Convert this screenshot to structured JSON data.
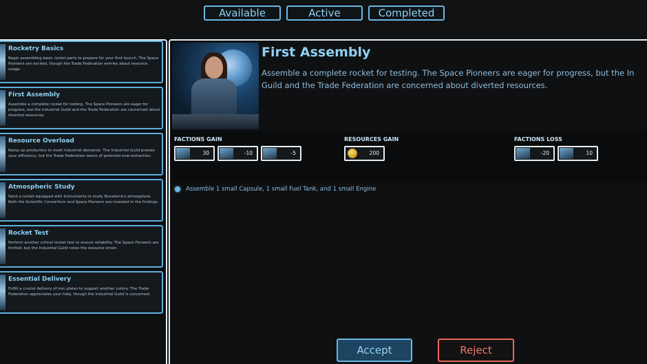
{
  "tabs": [
    {
      "label": "Available"
    },
    {
      "label": "Active"
    },
    {
      "label": "Completed"
    }
  ],
  "missions": [
    {
      "title": "Rocketry Basics",
      "description": "Begin assembling basic rocket parts to prepare for your first launch. The Space Pioneers are excited, though the Trade Federation worries about resource usage."
    },
    {
      "title": "First Assembly",
      "description": "Assemble a complete rocket for testing. The Space Pioneers are eager for progress, but the Industrial Guild and the Trade Federation are concerned about diverted resources."
    },
    {
      "title": "Resource Overload",
      "description": "Ramp up production to meet industrial demands. The Industrial Guild praises your efficiency, but the Trade Federation warns of potential over-extraction."
    },
    {
      "title": "Atmospheric Study",
      "description": "Send a rocket equipped with instruments to study Novaterra's atmosphere. Both the Scientific Consortium and Space Pioneers are invested in the findings."
    },
    {
      "title": "Rocket Test",
      "description": "Perform another critical rocket test to ensure reliability. The Space Pioneers are thrilled, but the Industrial Guild notes the resource strain."
    },
    {
      "title": "Essential Delivery",
      "description": "Fulfill a crucial delivery of iron plates to support another colony. The Trade Federation appreciates your help, though the Industrial Guild is concerned."
    }
  ],
  "detail": {
    "title": "First Assembly",
    "description_line1": "Assemble a complete rocket for testing. The Space Pioneers are eager for progress, but the In",
    "description_line2": "Guild and the Trade Federation are concerned about diverted resources.",
    "factions_gain_label": "FACTIONS GAIN",
    "resources_gain_label": "RESOURCES GAIN",
    "factions_loss_label": "FACTIONS LOSS",
    "factions_gain": [
      "30",
      "-10",
      "-5"
    ],
    "resources_gain": [
      "200"
    ],
    "factions_loss": [
      "-20",
      "10"
    ],
    "objective": "Assemble 1 small Capsule, 1 small Fuel Tank, and 1 small Engine"
  },
  "buttons": {
    "accept": "Accept",
    "reject": "Reject"
  },
  "colors": {
    "accent": "#6cb8e4",
    "reject": "#e8695a",
    "background": "#111214"
  }
}
